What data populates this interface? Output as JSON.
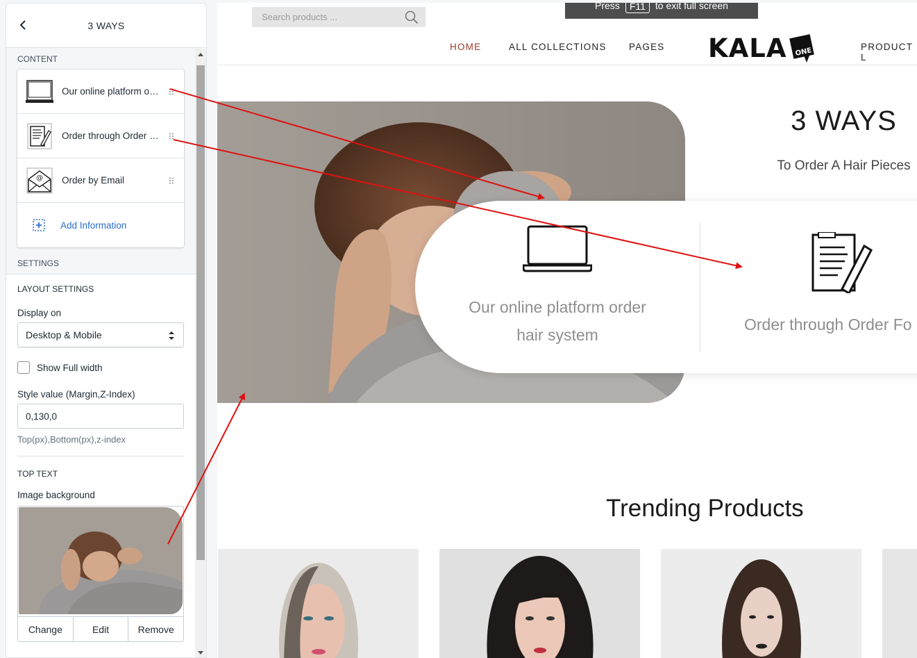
{
  "sidebar": {
    "title": "3 WAYS",
    "content_label": "CONTENT",
    "items": [
      {
        "label": "Our online platform order hair system",
        "icon": "laptop-icon"
      },
      {
        "label": "Order through Order Form",
        "icon": "order-form-icon"
      },
      {
        "label": "Order by Email",
        "icon": "email-icon"
      }
    ],
    "add_label": "Add Information",
    "settings_label": "SETTINGS",
    "layout_heading": "LAYOUT SETTINGS",
    "display_on_label": "Display on",
    "display_on_value": "Desktop & Mobile",
    "full_width_label": "Show Full width",
    "style_label": "Style value (Margin,Z-Index)",
    "style_value": "0,130,0",
    "style_help": "Top(px),Bottom(px),z-index",
    "top_text_heading": "TOP TEXT",
    "image_bg_label": "Image background",
    "image_buttons": {
      "change": "Change",
      "edit": "Edit",
      "remove": "Remove"
    }
  },
  "preview": {
    "search_placeholder": "Search products ...",
    "fullscreen_hint": {
      "prefix": "Press",
      "key": "F11",
      "suffix": "to exit full screen"
    },
    "nav": {
      "home": "HOME",
      "collections": "ALL COLLECTIONS",
      "pages": "PAGES",
      "product": "PRODUCT L"
    },
    "logo_text": "KALA",
    "logo_badge": "ONE",
    "ways_title": "3 WAYS",
    "ways_subtitle": "To Order A Hair Pieces",
    "way1_text": "Our online platform order hair system",
    "way2_text": "Order through Order Fo",
    "trending_title": "Trending Products"
  },
  "colors": {
    "accent_link": "#2c6ecb",
    "nav_active": "#9a3a2c",
    "annotation_arrow": "#e01010"
  }
}
